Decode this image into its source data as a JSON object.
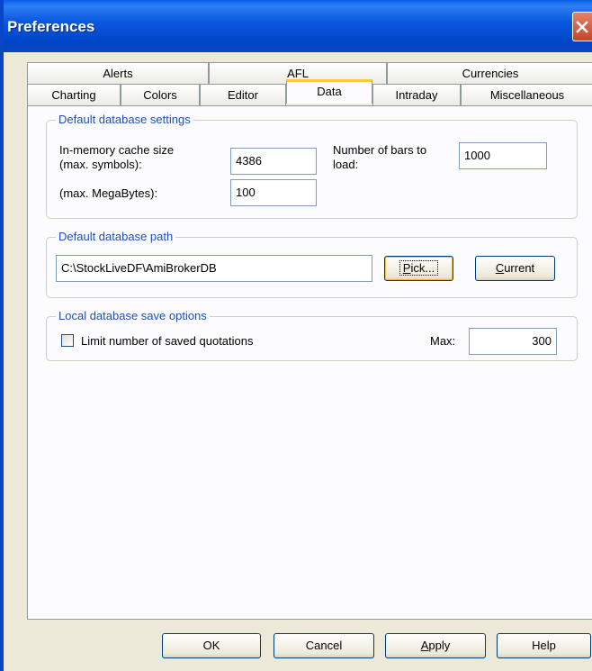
{
  "window": {
    "title": "Preferences"
  },
  "tabs": {
    "row1": [
      "Alerts",
      "AFL",
      "Currencies"
    ],
    "row2": [
      "Charting",
      "Colors",
      "Editor",
      "Data",
      "Intraday",
      "Miscellaneous"
    ],
    "active": "Data"
  },
  "db_settings": {
    "group_label": "Default database settings",
    "cache_label": "In-memory cache size\n(max. symbols):",
    "cache_value": "4386",
    "megabytes_label": "(max. MegaBytes):",
    "megabytes_value": "100",
    "bars_label": "Number of bars to\nload:",
    "bars_value": "1000"
  },
  "db_path": {
    "group_label": "Default database path",
    "path_value": "C:\\StockLiveDF\\AmiBrokerDB",
    "pick_button": {
      "pre": "",
      "accel": "P",
      "post": "ick..."
    },
    "current_button": {
      "pre": "",
      "accel": "C",
      "post": "urrent"
    }
  },
  "save_options": {
    "group_label": "Local database save options",
    "limit_label": "Limit number of saved quotations",
    "limit_checked": false,
    "max_label": "Max:",
    "max_value": "300"
  },
  "buttons": {
    "ok": "OK",
    "cancel": "Cancel",
    "apply": {
      "pre": "",
      "accel": "A",
      "post": "pply"
    },
    "help": "Help"
  },
  "colors": {
    "title_bar": "#0a59e0",
    "group_label": "#1c4fb8",
    "active_tab_highlight": "#ffc83c",
    "close_button": "#c4452c"
  }
}
